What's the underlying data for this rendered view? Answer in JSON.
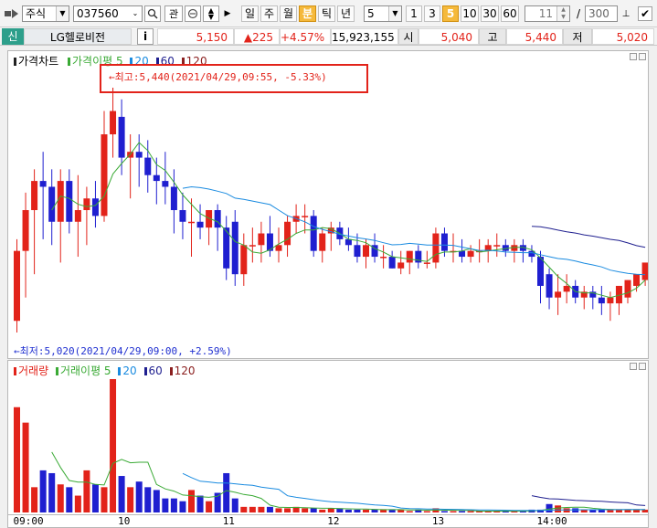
{
  "toolbar": {
    "type_select": "주식",
    "code_input": "037560",
    "search_icon": "magnifier-icon",
    "watch_label": "관",
    "period_buttons": [
      "일",
      "주",
      "월",
      "분",
      "틱",
      "년"
    ],
    "active_period": "분",
    "interval_select": "5",
    "interval_buttons": [
      "1",
      "3",
      "5",
      "10",
      "30",
      "60"
    ],
    "active_interval": "5",
    "page_value": "11",
    "page_sep": "/",
    "page_total": "300"
  },
  "info": {
    "badge": "신",
    "stock_name": "LG헬로비전",
    "info_icon": "i",
    "price": "5,150",
    "change": "▲225",
    "change_pct": "+4.57%",
    "volume": "15,923,155",
    "open_label": "시",
    "open_value": "5,040",
    "high_label": "고",
    "high_value": "5,440",
    "low_label": "저",
    "low_value": "5,020"
  },
  "price_pane": {
    "title": "가격차트",
    "legend": [
      {
        "label": "가격이평 5",
        "color": "#3aaa35"
      },
      {
        "label": "20",
        "color": "#1a8be0"
      },
      {
        "label": "60",
        "color": "#1f1f8f"
      },
      {
        "label": "120",
        "color": "#8b2020"
      }
    ],
    "high_annotation": "←최고:5,440(2021/04/29,09:55, -5.33%)",
    "low_annotation": "←최저:5,020(2021/04/29,09:00, +2.59%)"
  },
  "volume_pane": {
    "title": "거래량",
    "legend": [
      {
        "label": "거래이평 5",
        "color": "#3aaa35"
      },
      {
        "label": "20",
        "color": "#1a8be0"
      },
      {
        "label": "60",
        "color": "#1f1f8f"
      },
      {
        "label": "120",
        "color": "#8b2020"
      }
    ]
  },
  "x_axis": {
    "ticks": [
      "09:00",
      "10",
      "11",
      "12",
      "13",
      "14:00"
    ]
  },
  "colors": {
    "up": "#e2231a",
    "down": "#1f1fd0",
    "ma5": "#3aaa35",
    "ma20": "#1a8be0",
    "ma60": "#1f1f8f"
  },
  "chart_data": [
    {
      "type": "candlestick",
      "title": "가격차트",
      "interval": "5분",
      "x": [
        "09:00",
        "09:05",
        "09:10",
        "09:15",
        "09:20",
        "09:25",
        "09:30",
        "09:35",
        "09:40",
        "09:45",
        "09:50",
        "09:55",
        "10:00",
        "10:05",
        "10:10",
        "10:15",
        "10:20",
        "10:25",
        "10:30",
        "10:35",
        "10:40",
        "10:45",
        "10:50",
        "10:55",
        "11:00",
        "11:05",
        "11:10",
        "11:15",
        "11:20",
        "11:25",
        "11:30",
        "11:35",
        "11:40",
        "11:45",
        "11:50",
        "11:55",
        "12:00",
        "12:05",
        "12:10",
        "12:15",
        "12:20",
        "12:25",
        "12:30",
        "12:35",
        "12:40",
        "12:45",
        "12:50",
        "12:55",
        "13:00",
        "13:05",
        "13:10",
        "13:15",
        "13:20",
        "13:25",
        "13:30",
        "13:35",
        "13:40",
        "13:45",
        "13:50",
        "13:55",
        "14:00",
        "14:05",
        "14:10",
        "14:15",
        "14:20",
        "14:25",
        "14:30",
        "14:35",
        "14:40",
        "14:45",
        "14:50",
        "14:55",
        "15:00"
      ],
      "open": [
        5040,
        5160,
        5230,
        5280,
        5270,
        5210,
        5280,
        5210,
        5230,
        5250,
        5220,
        5360,
        5390,
        5320,
        5330,
        5320,
        5290,
        5280,
        5270,
        5230,
        5210,
        5210,
        5200,
        5230,
        5200,
        5210,
        5120,
        5170,
        5170,
        5190,
        5160,
        5170,
        5210,
        5220,
        5220,
        5160,
        5190,
        5200,
        5180,
        5170,
        5150,
        5170,
        5150,
        5150,
        5130,
        5140,
        5160,
        5140,
        5140,
        5190,
        5160,
        5160,
        5150,
        5160,
        5160,
        5170,
        5170,
        5160,
        5170,
        5160,
        5150,
        5120,
        5080,
        5090,
        5100,
        5080,
        5090,
        5080,
        5070,
        5070,
        5080,
        5100,
        5110
      ],
      "high": [
        5180,
        5260,
        5300,
        5330,
        5300,
        5300,
        5300,
        5290,
        5270,
        5280,
        5400,
        5440,
        5420,
        5360,
        5360,
        5350,
        5320,
        5330,
        5300,
        5260,
        5250,
        5240,
        5220,
        5240,
        5220,
        5230,
        5190,
        5200,
        5210,
        5220,
        5200,
        5220,
        5240,
        5240,
        5230,
        5200,
        5210,
        5210,
        5200,
        5190,
        5180,
        5190,
        5170,
        5160,
        5160,
        5160,
        5170,
        5160,
        5200,
        5200,
        5190,
        5180,
        5170,
        5180,
        5180,
        5190,
        5180,
        5180,
        5180,
        5170,
        5160,
        5130,
        5120,
        5120,
        5110,
        5100,
        5100,
        5100,
        5090,
        5100,
        5110,
        5120,
        5130
      ],
      "low": [
        5020,
        5080,
        5120,
        5180,
        5170,
        5140,
        5190,
        5150,
        5170,
        5200,
        5210,
        5320,
        5290,
        5250,
        5270,
        5260,
        5240,
        5240,
        5190,
        5180,
        5150,
        5180,
        5170,
        5160,
        5110,
        5100,
        5100,
        5140,
        5140,
        5150,
        5140,
        5150,
        5190,
        5190,
        5150,
        5140,
        5160,
        5170,
        5160,
        5140,
        5130,
        5140,
        5130,
        5130,
        5120,
        5120,
        5130,
        5130,
        5130,
        5150,
        5140,
        5140,
        5140,
        5140,
        5140,
        5150,
        5150,
        5140,
        5140,
        5140,
        5070,
        5060,
        5050,
        5070,
        5070,
        5060,
        5060,
        5050,
        5040,
        5050,
        5070,
        5090,
        5100
      ],
      "close": [
        5160,
        5230,
        5280,
        5270,
        5210,
        5280,
        5210,
        5230,
        5250,
        5220,
        5360,
        5400,
        5320,
        5330,
        5320,
        5290,
        5280,
        5270,
        5230,
        5210,
        5210,
        5200,
        5230,
        5200,
        5130,
        5120,
        5170,
        5170,
        5190,
        5160,
        5170,
        5210,
        5220,
        5220,
        5160,
        5190,
        5200,
        5180,
        5170,
        5150,
        5170,
        5150,
        5150,
        5130,
        5140,
        5160,
        5140,
        5140,
        5190,
        5160,
        5160,
        5150,
        5160,
        5160,
        5170,
        5170,
        5160,
        5170,
        5160,
        5150,
        5100,
        5080,
        5090,
        5100,
        5080,
        5090,
        5080,
        5070,
        5080,
        5100,
        5110,
        5120,
        5140
      ]
    },
    {
      "type": "bar",
      "title": "거래량",
      "x": [
        "09:00",
        "09:05",
        "09:10",
        "09:15",
        "09:20",
        "09:25",
        "09:30",
        "09:35",
        "09:40",
        "09:45",
        "09:50",
        "09:55",
        "10:00",
        "10:05",
        "10:10",
        "10:15",
        "10:20",
        "10:25",
        "10:30",
        "10:35",
        "10:40",
        "10:45",
        "10:50",
        "10:55",
        "11:00",
        "11:05",
        "11:10",
        "11:15",
        "11:20",
        "11:25",
        "11:30",
        "11:35",
        "11:40",
        "11:45",
        "11:50",
        "11:55",
        "12:00",
        "12:05",
        "12:10",
        "12:15",
        "12:20",
        "12:25",
        "12:30",
        "12:35",
        "12:40",
        "12:45",
        "12:50",
        "12:55",
        "13:00",
        "13:05",
        "13:10",
        "13:15",
        "13:20",
        "13:25",
        "13:30",
        "13:35",
        "13:40",
        "13:45",
        "13:50",
        "13:55",
        "14:00",
        "14:05",
        "14:10",
        "14:15",
        "14:20",
        "14:25",
        "14:30",
        "14:35",
        "14:40",
        "14:45",
        "14:50",
        "14:55",
        "15:00"
      ],
      "values": [
        75,
        64,
        18,
        30,
        28,
        20,
        18,
        12,
        30,
        20,
        18,
        95,
        26,
        18,
        22,
        18,
        16,
        10,
        10,
        8,
        16,
        12,
        8,
        14,
        28,
        10,
        4,
        4,
        4,
        4,
        3,
        3,
        4,
        3,
        3,
        2,
        3,
        3,
        2,
        2,
        2,
        2,
        2,
        2,
        2,
        1,
        2,
        1,
        3,
        1,
        1,
        1,
        1,
        1,
        1,
        1,
        1,
        1,
        1,
        2,
        2,
        6,
        5,
        3,
        3,
        2,
        2,
        2,
        2,
        2,
        2,
        2,
        2
      ]
    }
  ]
}
